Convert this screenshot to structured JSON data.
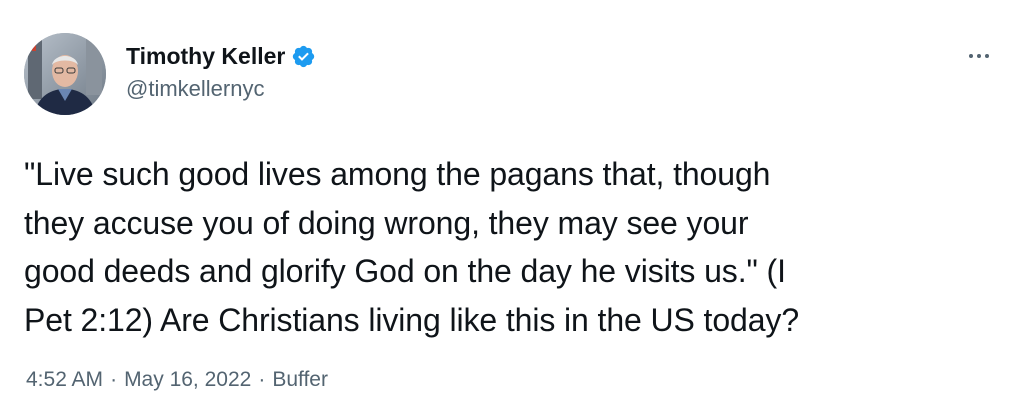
{
  "author": {
    "display_name": "Timothy Keller",
    "handle": "@timkellernyc",
    "verified": true,
    "verified_color": "#1d9bf0"
  },
  "tweet": {
    "text": "\"Live such good lives among the pagans that, though\nthey accuse you of doing wrong, they may see your\ngood deeds and glorify God on the day he visits us.\" (I\nPet 2:12) Are Christians living like this in the US today?",
    "time": "4:52 AM",
    "date": "May 16, 2022",
    "separator": "·",
    "source": "Buffer"
  },
  "icons": {
    "more": "more-options-icon",
    "verified": "verified-badge-icon"
  },
  "colors": {
    "text_primary": "#0f1419",
    "text_secondary": "#536471",
    "accent": "#1d9bf0"
  }
}
